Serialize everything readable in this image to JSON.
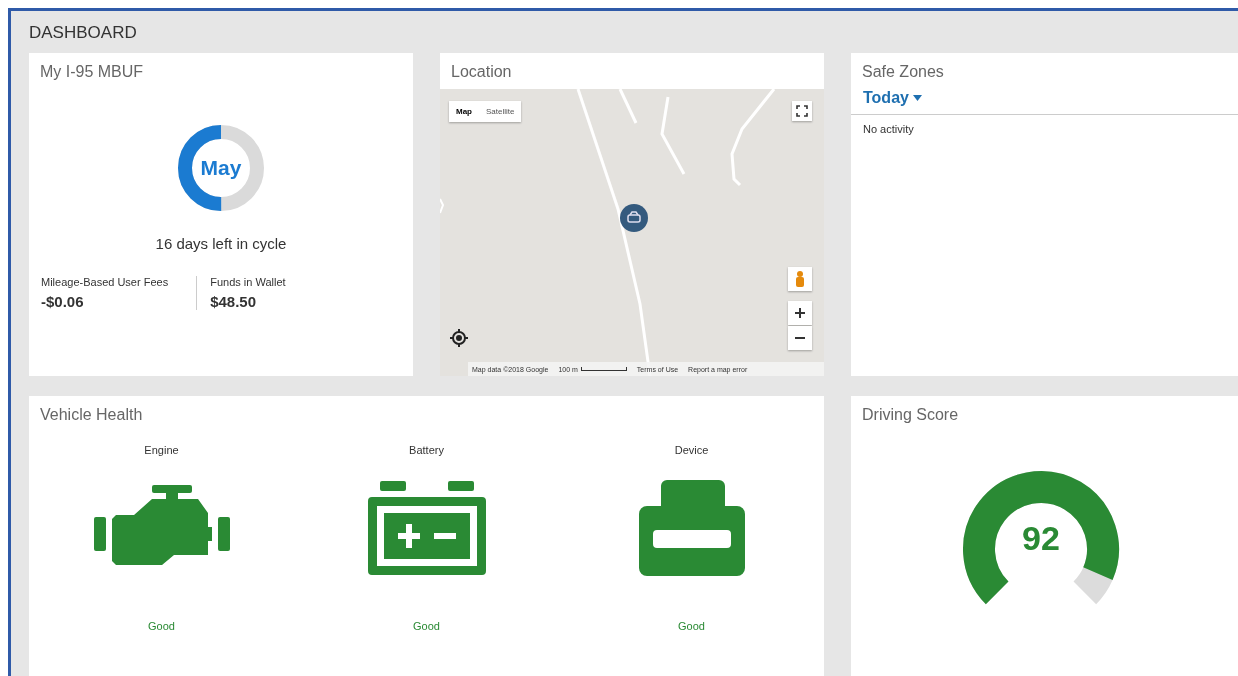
{
  "page": {
    "title": "DASHBOARD"
  },
  "mbuf": {
    "title": "My I-95 MBUF",
    "month": "May",
    "level": 0.5,
    "caption": "16 days left in cycle",
    "stats": [
      {
        "label": "Mileage-Based User Fees",
        "value": "-$0.06"
      },
      {
        "label": "Funds in Wallet",
        "value": "$48.50"
      }
    ]
  },
  "location": {
    "title": "Location",
    "map_types": [
      {
        "label": "Map",
        "selected": true
      },
      {
        "label": "Satellite",
        "selected": false
      }
    ],
    "attribution": "Map data ©2018 Google",
    "scale": "100 m",
    "terms": "Terms of Use",
    "report": "Report a map error"
  },
  "safe_zones": {
    "title": "Safe Zones",
    "period": "Today",
    "message": "No activity"
  },
  "vehicle_health": {
    "title": "Vehicle Health",
    "items": [
      {
        "kind": "engine",
        "label": "Engine",
        "status": "Good"
      },
      {
        "kind": "battery",
        "label": "Battery",
        "status": "Good"
      },
      {
        "kind": "device",
        "label": "Device",
        "status": "Good"
      }
    ]
  },
  "driving_score": {
    "title": "Driving Score",
    "score": "92"
  }
}
